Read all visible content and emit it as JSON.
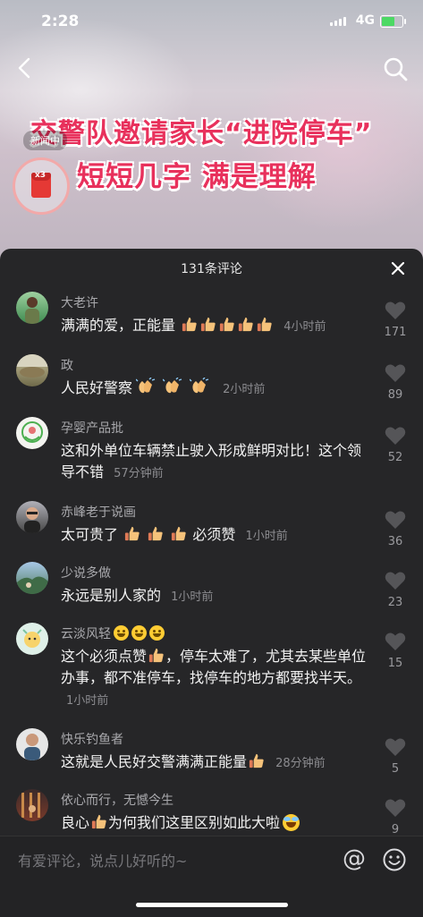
{
  "status_bar": {
    "time": "2:28",
    "network": "4G"
  },
  "video": {
    "headline_line1": "交警队邀请家长“进院停车”",
    "headline_line2": "短短几字 满是理解",
    "overlay_tag": "新闻中",
    "redpacket_count": "x3"
  },
  "comments_sheet": {
    "title": "131条评论",
    "comments": [
      {
        "name": "大老许",
        "text": "满满的爱，正能量",
        "time": "4小时前",
        "likes": "171"
      },
      {
        "name": "政",
        "text": "人民好警察",
        "time": "2小时前",
        "likes": "89"
      },
      {
        "name": "孕婴产品批",
        "text": "这和外单位车辆禁止驶入形成鲜明对比！这个领导不错",
        "time": "57分钟前",
        "likes": "52"
      },
      {
        "name": "赤峰老于说画",
        "text": "太可贵了",
        "text_after": "必须赞",
        "time": "1小时前",
        "likes": "36"
      },
      {
        "name": "少说多做",
        "text": "永远是别人家的",
        "time": "1小时前",
        "likes": "23"
      },
      {
        "name": "云淡风轻",
        "text": "这个必须点赞",
        "text_after": "，停车太难了，尤其去某些单位办事，都不准停车，找停车的地方都要找半天。",
        "time": "1小时前",
        "likes": "15"
      },
      {
        "name": "快乐钓鱼者",
        "text": "这就是人民好交警满满正能量",
        "time": "28分钟前",
        "likes": "5"
      },
      {
        "name": "依心而行，无憾今生",
        "text": "良心",
        "text_after": "为何我们这里区别如此大啦",
        "likes": "9"
      }
    ]
  },
  "input_bar": {
    "placeholder": "有爱评论，说点儿好听的~",
    "at_label": "@"
  },
  "colors": {
    "accent": "#e8315c",
    "sheet_bg": "#262628",
    "thumb": "#f5c27a"
  }
}
